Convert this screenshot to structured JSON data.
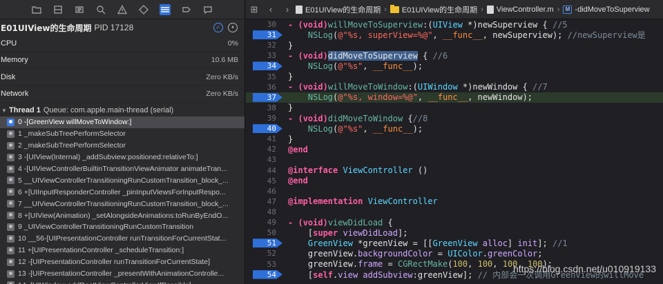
{
  "navigator": {
    "toolbar_icons": [
      "folder-icon",
      "source-control-icon",
      "symbol-icon",
      "find-icon",
      "issue-icon",
      "test-icon",
      "debug-icon",
      "breakpoint-icon",
      "report-icon"
    ],
    "process": {
      "name": "E01UIView的生命周期",
      "pid": "PID 17128"
    },
    "gauges": [
      {
        "name": "CPU",
        "value": "0%"
      },
      {
        "name": "Memory",
        "value": "10.6 MB"
      },
      {
        "name": "Disk",
        "value": "Zero KB/s"
      },
      {
        "name": "Network",
        "value": "Zero KB/s"
      }
    ],
    "thread": {
      "label": "Thread 1",
      "queue": "Queue: com.apple.main-thread (serial)"
    },
    "frames": [
      "0 -[GreenView willMoveToWindow:]",
      "1 _makeSubTreePerformSelector",
      "2 _makeSubTreePerformSelector",
      "3 -[UIView(Internal) _addSubview:positioned:relativeTo:]",
      "4 -[UIViewControllerBuiltinTransitionViewAnimator animateTran...",
      "5 __UIViewControllerTransitioningRunCustomTransition_block_...",
      "6 +[UIInputResponderController _pinInputViewsForInputRespo...",
      "7 __UIViewControllerTransitioningRunCustomTransition_block_...",
      "8 +[UIView(Animation) _setAlongsideAnimations:toRunByEndO...",
      "9 _UIViewControllerTransitioningRunCustomTransition",
      "10 __56-[UIPresentationController runTransitionForCurrentStat...",
      "11 +[UIPresentationController _scheduleTransition:]",
      "12 -[UIPresentationController runTransitionForCurrentState]",
      "13 -[UIPresentationController _presentWithAnimationControlle...",
      "14 -[UIWindow addRootViewControllerViewIfPossible]"
    ]
  },
  "editor": {
    "breadcrumbs": [
      {
        "text": "E01UIView的生命周期",
        "icon": "project-icon"
      },
      {
        "text": "E01UIView的生命周期",
        "icon": "folder-icon"
      },
      {
        "text": "ViewController.m",
        "icon": "file-icon"
      },
      {
        "text": "-didMoveToSuperview",
        "icon": "method-icon"
      }
    ],
    "lines": [
      {
        "n": "30",
        "bp": false,
        "current": false,
        "parts": [
          [
            "kw",
            "- ("
          ],
          [
            "kw",
            "void"
          ],
          [
            "kw",
            ")"
          ],
          [
            "fn",
            "willMoveToSuperview"
          ],
          [
            "plain",
            ":("
          ],
          [
            "cls",
            "UIView"
          ],
          [
            "plain",
            " *)newSuperview { "
          ],
          [
            "cmt",
            "//5"
          ]
        ]
      },
      {
        "n": "31",
        "bp": true,
        "current": false,
        "parts": [
          [
            "plain",
            "    "
          ],
          [
            "fn",
            "NSLog"
          ],
          [
            "plain",
            "("
          ],
          [
            "str",
            "@\"%s, superView=%@\""
          ],
          [
            "plain",
            ", "
          ],
          [
            "dir",
            "__func__"
          ],
          [
            "plain",
            ", newSuperview); "
          ],
          [
            "cmt",
            "//newSuperview是"
          ]
        ]
      },
      {
        "n": "32",
        "bp": false,
        "current": false,
        "parts": [
          [
            "plain",
            "}"
          ]
        ]
      },
      {
        "n": "33",
        "bp": false,
        "current": false,
        "parts": [
          [
            "kw",
            "- ("
          ],
          [
            "kw",
            "void"
          ],
          [
            "kw",
            ")"
          ],
          [
            "hl",
            "didMoveToSuperview"
          ],
          [
            "plain",
            " { "
          ],
          [
            "cmt",
            "//6"
          ]
        ]
      },
      {
        "n": "34",
        "bp": true,
        "current": false,
        "parts": [
          [
            "plain",
            "    "
          ],
          [
            "fn",
            "NSLog"
          ],
          [
            "plain",
            "("
          ],
          [
            "str",
            "@\"%s\""
          ],
          [
            "plain",
            ", "
          ],
          [
            "dir",
            "__func__"
          ],
          [
            "plain",
            ");"
          ]
        ]
      },
      {
        "n": "35",
        "bp": false,
        "current": false,
        "parts": [
          [
            "plain",
            "}"
          ]
        ]
      },
      {
        "n": "36",
        "bp": false,
        "current": false,
        "parts": [
          [
            "kw",
            "- ("
          ],
          [
            "kw",
            "void"
          ],
          [
            "kw",
            ")"
          ],
          [
            "fn",
            "willMoveToWindow"
          ],
          [
            "plain",
            ":("
          ],
          [
            "cls",
            "UIWindow"
          ],
          [
            "plain",
            " *)newWindow { "
          ],
          [
            "cmt",
            "//7"
          ]
        ]
      },
      {
        "n": "37",
        "bp": true,
        "current": true,
        "parts": [
          [
            "plain",
            "    "
          ],
          [
            "fn",
            "NSLog"
          ],
          [
            "plain",
            "("
          ],
          [
            "str",
            "@\"%s, window=%@\""
          ],
          [
            "plain",
            ", "
          ],
          [
            "dir",
            "__func__"
          ],
          [
            "plain",
            ", newWindow);"
          ]
        ]
      },
      {
        "n": "38",
        "bp": false,
        "current": false,
        "parts": [
          [
            "plain",
            "}"
          ]
        ]
      },
      {
        "n": "39",
        "bp": false,
        "current": false,
        "parts": [
          [
            "kw",
            "- ("
          ],
          [
            "kw",
            "void"
          ],
          [
            "kw",
            ")"
          ],
          [
            "fn",
            "didMoveToWindow"
          ],
          [
            "plain",
            " {"
          ],
          [
            "cmt",
            "//8"
          ]
        ]
      },
      {
        "n": "40",
        "bp": true,
        "current": false,
        "parts": [
          [
            "plain",
            "    "
          ],
          [
            "fn",
            "NSLog"
          ],
          [
            "plain",
            "("
          ],
          [
            "str",
            "@\"%s\""
          ],
          [
            "plain",
            ", "
          ],
          [
            "dir",
            "__func__"
          ],
          [
            "plain",
            ");"
          ]
        ]
      },
      {
        "n": "41",
        "bp": false,
        "current": false,
        "parts": [
          [
            "plain",
            "}"
          ]
        ]
      },
      {
        "n": "42",
        "bp": false,
        "current": false,
        "parts": [
          [
            "kw",
            "@end"
          ]
        ]
      },
      {
        "n": "43",
        "bp": false,
        "current": false,
        "parts": []
      },
      {
        "n": "44",
        "bp": false,
        "current": false,
        "parts": [
          [
            "kw",
            "@interface"
          ],
          [
            "plain",
            " "
          ],
          [
            "cls",
            "ViewController"
          ],
          [
            "plain",
            " ()"
          ]
        ]
      },
      {
        "n": "45",
        "bp": false,
        "current": false,
        "parts": [
          [
            "kw",
            "@end"
          ]
        ]
      },
      {
        "n": "46",
        "bp": false,
        "current": false,
        "parts": []
      },
      {
        "n": "47",
        "bp": false,
        "current": false,
        "parts": [
          [
            "kw",
            "@implementation"
          ],
          [
            "plain",
            " "
          ],
          [
            "cls",
            "ViewController"
          ]
        ]
      },
      {
        "n": "48",
        "bp": false,
        "current": false,
        "parts": []
      },
      {
        "n": "49",
        "bp": false,
        "current": false,
        "parts": [
          [
            "kw",
            "- ("
          ],
          [
            "kw",
            "void"
          ],
          [
            "kw",
            ")"
          ],
          [
            "fn",
            "viewDidLoad"
          ],
          [
            "plain",
            " {"
          ]
        ]
      },
      {
        "n": "50",
        "bp": false,
        "current": false,
        "parts": [
          [
            "plain",
            "    ["
          ],
          [
            "kw",
            "super"
          ],
          [
            "plain",
            " "
          ],
          [
            "sys",
            "viewDidLoad"
          ],
          [
            "plain",
            "];"
          ]
        ]
      },
      {
        "n": "51",
        "bp": true,
        "current": false,
        "parts": [
          [
            "plain",
            "    "
          ],
          [
            "cls",
            "GreenView"
          ],
          [
            "plain",
            " *greenView = [["
          ],
          [
            "cls",
            "GreenView"
          ],
          [
            "plain",
            " "
          ],
          [
            "sys",
            "alloc"
          ],
          [
            "plain",
            "] "
          ],
          [
            "sys",
            "init"
          ],
          [
            "plain",
            "]; "
          ],
          [
            "cmt",
            "//1"
          ]
        ]
      },
      {
        "n": "52",
        "bp": false,
        "current": false,
        "parts": [
          [
            "plain",
            "    greenView."
          ],
          [
            "sys",
            "backgroundColor"
          ],
          [
            "plain",
            " = "
          ],
          [
            "cls",
            "UIColor"
          ],
          [
            "plain",
            "."
          ],
          [
            "sys",
            "greenColor"
          ],
          [
            "plain",
            ";"
          ]
        ]
      },
      {
        "n": "53",
        "bp": false,
        "current": false,
        "parts": [
          [
            "plain",
            "    greenView."
          ],
          [
            "sys",
            "frame"
          ],
          [
            "plain",
            " = "
          ],
          [
            "fn",
            "CGRectMake"
          ],
          [
            "plain",
            "("
          ],
          [
            "num",
            "100"
          ],
          [
            "plain",
            ", "
          ],
          [
            "num",
            "100"
          ],
          [
            "plain",
            ", "
          ],
          [
            "num",
            "100"
          ],
          [
            "plain",
            ", "
          ],
          [
            "num",
            "100"
          ],
          [
            "plain",
            ");"
          ]
        ]
      },
      {
        "n": "54",
        "bp": true,
        "current": false,
        "parts": [
          [
            "plain",
            "    ["
          ],
          [
            "kw",
            "self"
          ],
          [
            "plain",
            "."
          ],
          [
            "sys",
            "view"
          ],
          [
            "plain",
            " "
          ],
          [
            "sys",
            "addSubview"
          ],
          [
            "plain",
            ":greenView]; "
          ],
          [
            "cmt",
            "// 内部会一次调用GreenView的willMove"
          ]
        ]
      }
    ]
  },
  "watermark": "https://blog.csdn.net/u010919133"
}
